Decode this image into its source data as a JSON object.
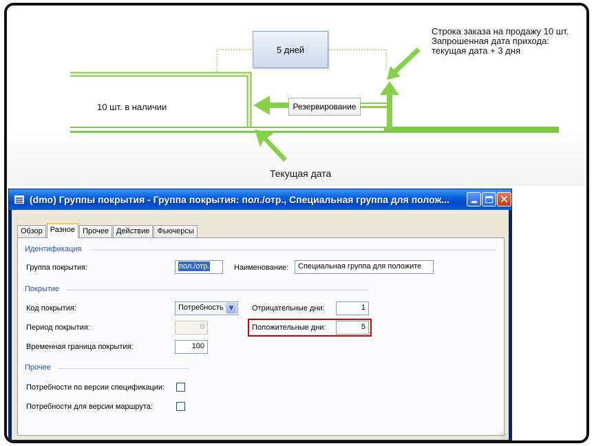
{
  "diagram": {
    "days_box": "5 дней",
    "reservation_box": "Резервирование",
    "stock_label": "10 шт. в наличии",
    "today_label": "Текущая дата",
    "order_lines": [
      "Строка заказа на продажу 10 шт.",
      "Запрошенная дата прихода:",
      "текущая дата + 3 дня"
    ],
    "colors": {
      "arrow_green": "#86d04a",
      "line_green": "#7cc744",
      "box_blue": "#cdd9ee"
    }
  },
  "window": {
    "title": "(dmo) Группы покрытия - Группа покрытия: пол./отр., Специальная группа для полож...",
    "icon": "form-icon",
    "controls": {
      "minimize": "minimize-icon",
      "maximize": "maximize-icon",
      "close": "✕"
    },
    "tabs": [
      {
        "label": "Обзор",
        "active": false
      },
      {
        "label": "Разное",
        "active": true
      },
      {
        "label": "Прочее",
        "active": false
      },
      {
        "label": "Действие",
        "active": false
      },
      {
        "label": "Фьючерсы",
        "active": false
      }
    ],
    "identification": {
      "group_label": "Идентификация",
      "coverage_group_label": "Группа покрытия:",
      "coverage_group_value": "пол./отр.",
      "name_label": "Наименование:",
      "name_value": "Специальная группа для положите"
    },
    "coverage": {
      "group_label": "Покрытие",
      "code_label": "Код покрытия:",
      "code_value": "Потребность",
      "period_label": "Период покрытия:",
      "period_value": "0",
      "time_fence_label": "Временная граница покрытия:",
      "time_fence_value": "100",
      "negative_days_label": "Отрицательные дни:",
      "negative_days_value": "1",
      "positive_days_label": "Положительные дни:",
      "positive_days_value": "5"
    },
    "other": {
      "group_label": "Прочее",
      "bom_version_label": "Потребности по версии спецификации:",
      "bom_version_checked": false,
      "route_version_label": "Потребности для версии маршрута:",
      "route_version_checked": false
    },
    "highlight_color": "#d40000"
  }
}
